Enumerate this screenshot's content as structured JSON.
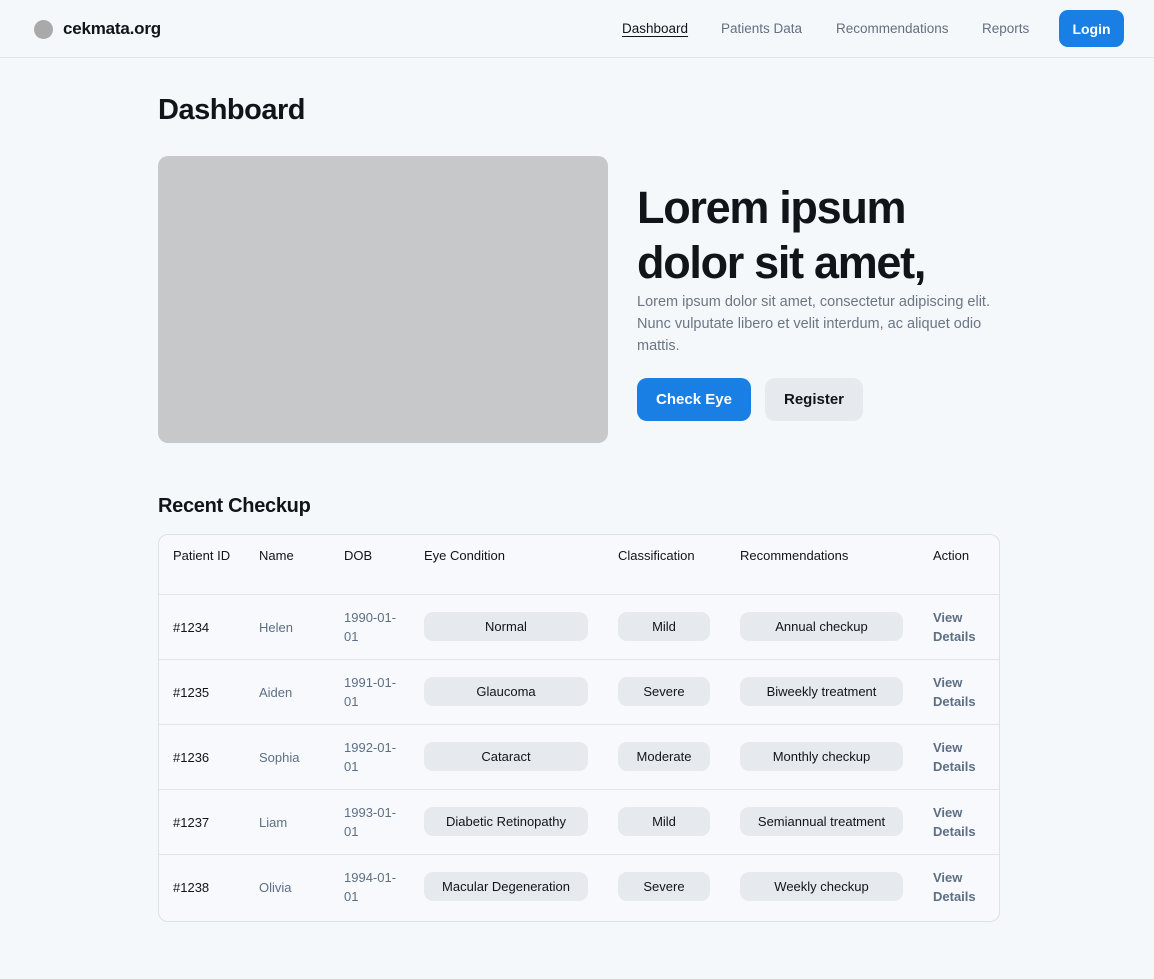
{
  "brand": {
    "name": "cekmata.org",
    "dot_color": "#a9a9a9"
  },
  "nav": {
    "items": [
      {
        "label": "Dashboard",
        "active": true
      },
      {
        "label": "Patients Data",
        "active": false
      },
      {
        "label": "Recommendations",
        "active": false
      },
      {
        "label": "Reports",
        "active": false
      }
    ],
    "login_label": "Login"
  },
  "page": {
    "title": "Dashboard"
  },
  "hero": {
    "heading": "Lorem ipsum dolor sit amet,",
    "text": "Lorem ipsum dolor sit amet, consectetur adipiscing elit. Nunc vulputate libero et velit interdum, ac aliquet odio mattis.",
    "primary_button": "Check Eye",
    "secondary_button": "Register"
  },
  "recent": {
    "title": "Recent Checkup",
    "columns": [
      "Patient ID",
      "Name",
      "DOB",
      "Eye Condition",
      "Classification",
      "Recommendations",
      "Action"
    ],
    "rows": [
      {
        "id": "#1234",
        "name": "Helen",
        "dob": "1990-01-01",
        "condition": "Normal",
        "classification": "Mild",
        "recommendation": "Annual checkup",
        "action": "View Details"
      },
      {
        "id": "#1235",
        "name": "Aiden",
        "dob": "1991-01-01",
        "condition": "Glaucoma",
        "classification": "Severe",
        "recommendation": "Biweekly treatment",
        "action": "View Details"
      },
      {
        "id": "#1236",
        "name": "Sophia",
        "dob": "1992-01-01",
        "condition": "Cataract",
        "classification": "Moderate",
        "recommendation": "Monthly checkup",
        "action": "View Details"
      },
      {
        "id": "#1237",
        "name": "Liam",
        "dob": "1993-01-01",
        "condition": "Diabetic Retinopathy",
        "classification": "Mild",
        "recommendation": "Semiannual treatment",
        "action": "View Details"
      },
      {
        "id": "#1238",
        "name": "Olivia",
        "dob": "1994-01-01",
        "condition": "Macular Degeneration",
        "classification": "Severe",
        "recommendation": "Weekly checkup",
        "action": "View Details"
      }
    ]
  },
  "colors": {
    "accent": "#1a7fe4",
    "background": "#f5f8fb",
    "pill": "#e6eaee",
    "muted_text": "#5c6f85"
  }
}
